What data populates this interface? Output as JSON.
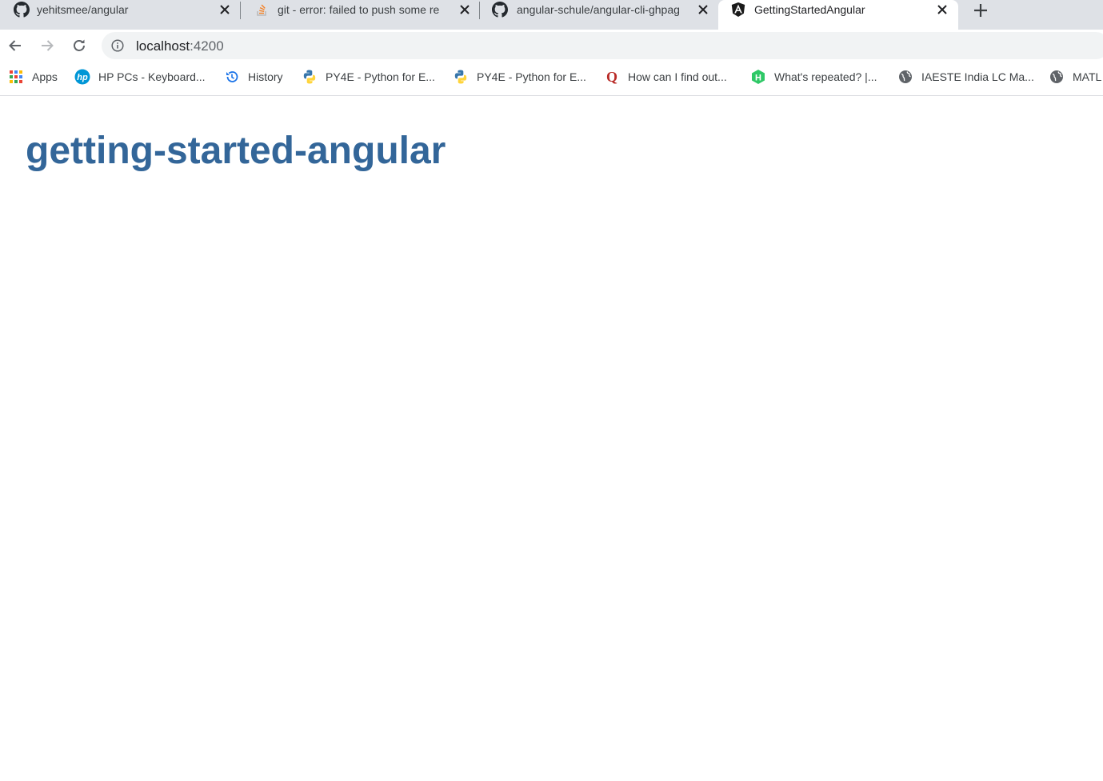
{
  "browser": {
    "tabs": [
      {
        "title": "yehitsmee/angular",
        "favicon": "github-icon",
        "active": false
      },
      {
        "title": "git - error: failed to push some re",
        "favicon": "stackoverflow-icon",
        "active": false
      },
      {
        "title": "angular-schule/angular-cli-ghpag",
        "favicon": "github-icon",
        "active": false
      },
      {
        "title": "GettingStartedAngular",
        "favicon": "angular-icon",
        "active": true
      }
    ],
    "new_tab_icon": "plus-icon",
    "address_bar": {
      "host": "localhost",
      "port": ":4200",
      "icon": "info-icon"
    },
    "bookmarks": [
      {
        "label": "Apps",
        "icon": "apps-grid-icon"
      },
      {
        "label": "HP PCs - Keyboard...",
        "icon": "hp-icon"
      },
      {
        "label": "History",
        "icon": "history-icon"
      },
      {
        "label": "PY4E - Python for E...",
        "icon": "python-icon"
      },
      {
        "label": "PY4E - Python for E...",
        "icon": "python-icon"
      },
      {
        "label": "How can I find out...",
        "icon": "quora-icon"
      },
      {
        "label": "What's repeated? |...",
        "icon": "hackerrank-icon"
      },
      {
        "label": "IAESTE India LC Ma...",
        "icon": "globe-icon"
      },
      {
        "label": "MATL",
        "icon": "globe-icon"
      }
    ]
  },
  "page": {
    "heading": "getting-started-angular"
  },
  "colors": {
    "heading": "#336699",
    "tab_strip": "#dee1e6",
    "omnibox": "#f1f3f4"
  }
}
